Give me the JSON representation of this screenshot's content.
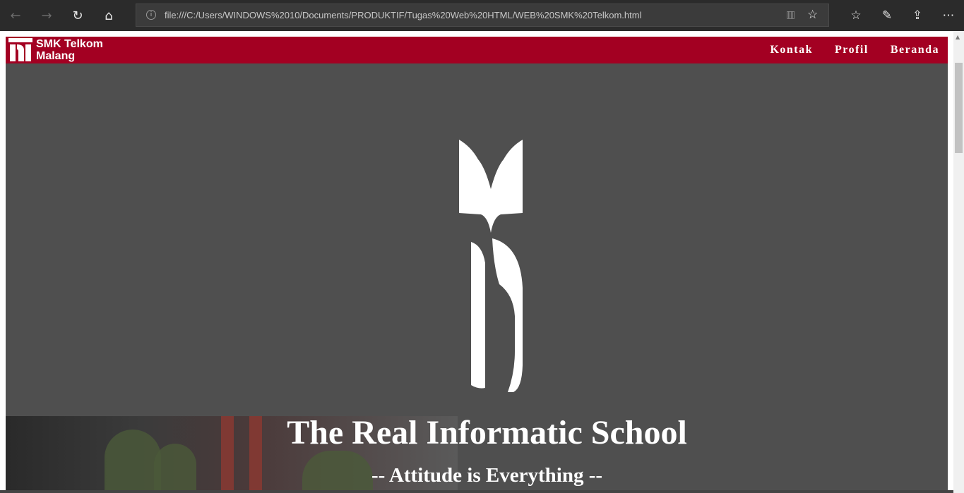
{
  "browser": {
    "url": "file:///C:/Users/WINDOWS%2010/Documents/PRODUKTIF/Tugas%20Web%20HTML/WEB%20SMK%20Telkom.html",
    "icons": {
      "back": "back-arrow-icon",
      "forward": "forward-arrow-icon",
      "refresh": "refresh-icon",
      "home": "home-icon",
      "info": "info-icon",
      "reading_view": "reading-view-icon",
      "favorite": "star-icon",
      "favorites_list": "favorites-list-icon",
      "notes": "pen-icon",
      "share": "share-icon",
      "more": "more-icon"
    }
  },
  "site": {
    "brand_line1": "SMK Telkom",
    "brand_line2": "Malang",
    "nav": [
      {
        "label": "Kontak"
      },
      {
        "label": "Profil"
      },
      {
        "label": "Beranda"
      }
    ],
    "hero_title": "The Real Informatic School",
    "hero_subtitle": "-- Attitude is Everything --"
  },
  "colors": {
    "header": "#a30022",
    "page_bg": "#4f4f4f",
    "browser_bar": "#2b2b2b"
  }
}
